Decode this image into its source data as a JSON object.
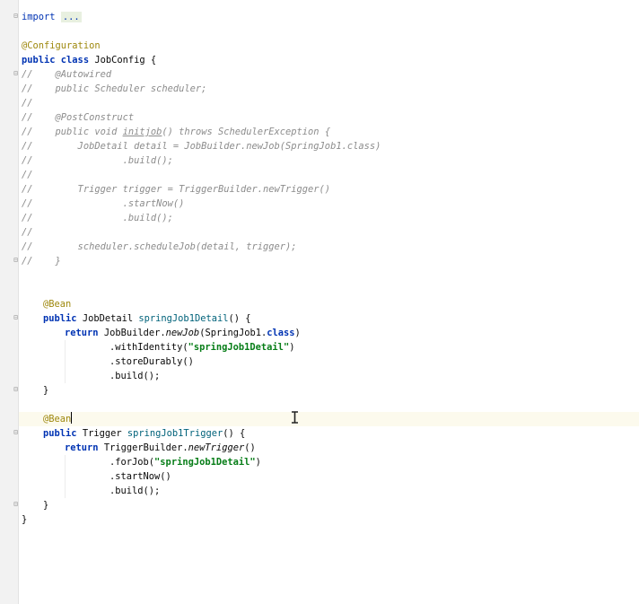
{
  "editor": {
    "lines": {
      "l1_kw": "import",
      "l1_fold": "...",
      "l2_ann": "@Configuration",
      "l3_kw": "public class",
      "l3_name": "JobConfig",
      "l3_brace": "{",
      "c1": "//    @Autowired",
      "c2": "//    public Scheduler scheduler;",
      "c3": "//",
      "c4": "//    @PostConstruct",
      "c5_a": "//    public void ",
      "c5_b": "initjob",
      "c5_c": "() throws SchedulerException {",
      "c6": "//        JobDetail detail = JobBuilder.newJob(SpringJob1.class)",
      "c7": "//                .build();",
      "c8": "//",
      "c9": "//        Trigger trigger = TriggerBuilder.newTrigger()",
      "c10": "//                .startNow()",
      "c11": "//                .build();",
      "c12": "//",
      "c13": "//        scheduler.scheduleJob(detail, trigger);",
      "c14": "//    }",
      "b1_ann": "@Bean",
      "b1_kw": "public",
      "b1_type": "JobDetail",
      "b1_name": "springJob1Detail",
      "b1_rest": "() {",
      "b1_ret_kw": "return",
      "b1_ret_a": "JobBuilder.",
      "b1_ret_b": "newJob",
      "b1_ret_c": "(SpringJob1.",
      "b1_ret_d": "class",
      "b1_ret_e": ")",
      "b1_with_a": ".withIdentity(",
      "b1_with_str": "\"springJob1Detail\"",
      "b1_with_b": ")",
      "b1_store": ".storeDurably()",
      "b1_build": ".build();",
      "b1_close": "}",
      "b2_ann": "@Bean",
      "b2_kw": "public",
      "b2_type": "Trigger",
      "b2_name": "springJob1Trigger",
      "b2_rest": "() {",
      "b2_ret_kw": "return",
      "b2_ret_a": "TriggerBuilder.",
      "b2_ret_b": "newTrigger",
      "b2_ret_c": "()",
      "b2_for_a": ".forJob(",
      "b2_for_str": "\"springJob1Detail\"",
      "b2_for_b": ")",
      "b2_start": ".startNow()",
      "b2_build": ".build();",
      "b2_close": "}",
      "class_close": "}"
    }
  }
}
